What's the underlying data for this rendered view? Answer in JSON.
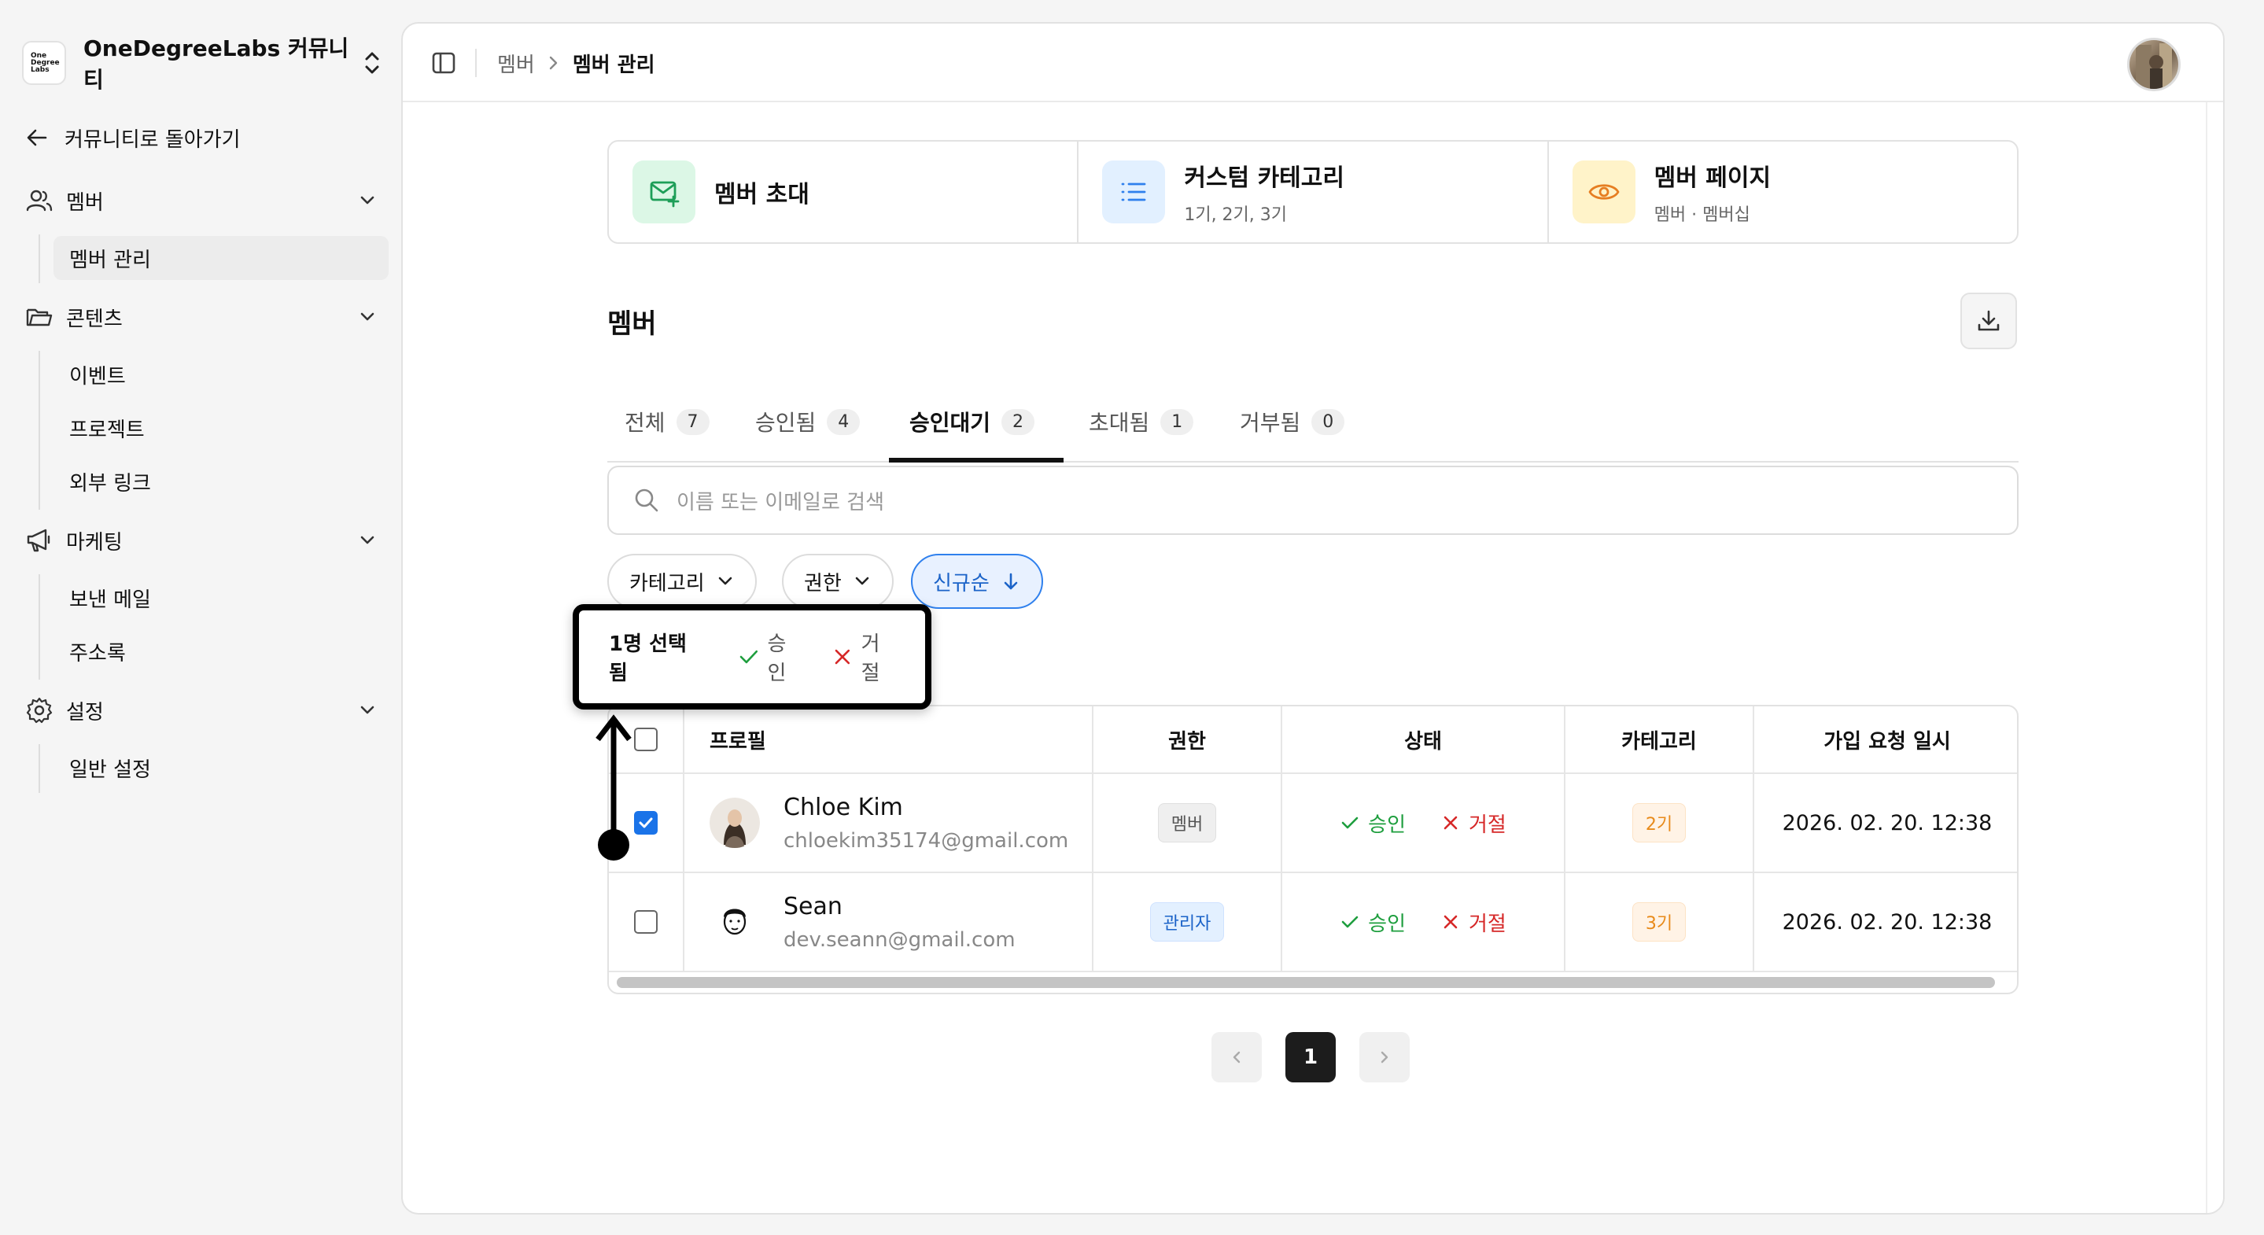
{
  "org": {
    "logo_lines": [
      "One",
      "Degree",
      "Labs"
    ],
    "name": "OneDegreeLabs 커뮤니티"
  },
  "sidebar": {
    "back_label": "커뮤니티로 돌아가기",
    "groups": [
      {
        "label": "멤버",
        "icon": "users-icon",
        "items": [
          "멤버 관리"
        ]
      },
      {
        "label": "콘텐츠",
        "icon": "folder-icon",
        "items": [
          "이벤트",
          "프로젝트",
          "외부 링크"
        ]
      },
      {
        "label": "마케팅",
        "icon": "megaphone-icon",
        "items": [
          "보낸 메일",
          "주소록"
        ]
      },
      {
        "label": "설정",
        "icon": "gear-icon",
        "items": [
          "일반 설정"
        ]
      }
    ],
    "active_item": "멤버 관리"
  },
  "breadcrumb": {
    "parent": "멤버",
    "current": "멤버 관리"
  },
  "quick_cards": [
    {
      "title": "멤버 초대",
      "subtitle": "",
      "icon": "mail-plus-icon"
    },
    {
      "title": "커스텀 카테고리",
      "subtitle": "1기, 2기, 3기",
      "icon": "list-icon"
    },
    {
      "title": "멤버 페이지",
      "subtitle": "멤버 · 멤버십",
      "icon": "eye-icon"
    }
  ],
  "section_title": "멤버",
  "tabs": [
    {
      "label": "전체",
      "count": "7"
    },
    {
      "label": "승인됨",
      "count": "4"
    },
    {
      "label": "승인대기",
      "count": "2"
    },
    {
      "label": "초대됨",
      "count": "1"
    },
    {
      "label": "거부됨",
      "count": "0"
    }
  ],
  "active_tab": "승인대기",
  "search": {
    "placeholder": "이름 또는 이메일로 검색"
  },
  "filters": {
    "category": "카테고리",
    "role": "권한",
    "sort": "신규순"
  },
  "selection": {
    "count_label": "1명 선택됨",
    "approve": "승인",
    "reject": "거절"
  },
  "table": {
    "headers": [
      "프로필",
      "권한",
      "상태",
      "카테고리",
      "가입 요청 일시"
    ],
    "rows": [
      {
        "name": "Chloe Kim",
        "email": "chloekim35174@gmail.com",
        "role": "멤버",
        "approve": "승인",
        "reject": "거절",
        "category": "2기",
        "date": "2026. 02. 20. 12:38",
        "checked": true
      },
      {
        "name": "Sean",
        "email": "dev.seann@gmail.com",
        "role": "관리자",
        "approve": "승인",
        "reject": "거절",
        "category": "3기",
        "date": "2026. 02. 20. 12:38",
        "checked": false
      }
    ]
  },
  "pagination": {
    "current": "1"
  },
  "colors": {
    "approve": "#1e9e3e",
    "reject": "#d62828",
    "accent": "#1a73e8"
  }
}
